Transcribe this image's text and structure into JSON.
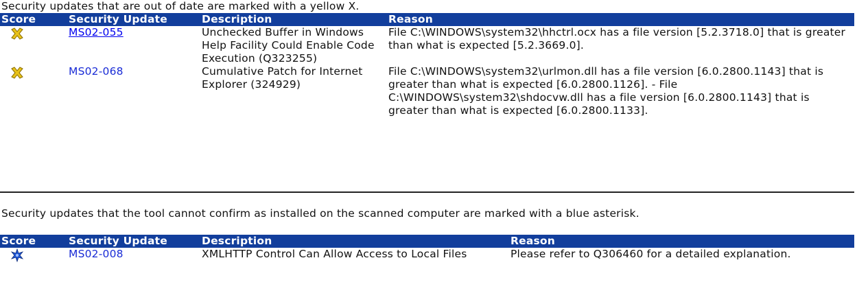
{
  "section1": {
    "intro": "Security updates that are out of date are marked with a yellow X.",
    "headers": {
      "score": "Score",
      "update": "Security Update",
      "description": "Description",
      "reason": "Reason"
    },
    "rows": [
      {
        "icon": "yellow-x-icon",
        "id": "MS02-055",
        "description": "Unchecked Buffer in Windows Help Facility Could Enable Code Execution (Q323255)",
        "reason": "File C:\\WINDOWS\\system32\\hhctrl.ocx has a file version [5.2.3718.0] that is greater than what is expected [5.2.3669.0]."
      },
      {
        "icon": "yellow-x-icon",
        "id": "MS02-068",
        "description": "Cumulative Patch for Internet Explorer (324929)",
        "reason": "File C:\\WINDOWS\\system32\\urlmon.dll has a file version [6.0.2800.1143] that is greater than what is expected [6.0.2800.1126]. - File C:\\WINDOWS\\system32\\shdocvw.dll has a file version [6.0.2800.1143] that is greater than what is expected [6.0.2800.1133]."
      }
    ]
  },
  "section2": {
    "intro": "Security updates that the tool cannot confirm as installed on the scanned computer are marked with a blue asterisk.",
    "headers": {
      "score": "Score",
      "update": "Security Update",
      "description": "Description",
      "reason": "Reason"
    },
    "rows": [
      {
        "icon": "blue-asterisk-icon",
        "id": "MS02-008",
        "description": "XMLHTTP Control Can Allow Access to Local Files",
        "reason": "Please refer to Q306460 for a detailed explanation."
      }
    ]
  },
  "colors": {
    "header_bg": "#123e9c",
    "header_text": "#ffffff",
    "link": "#0000ee",
    "warning_icon": "#e8c21a",
    "info_icon": "#1f57d6"
  }
}
